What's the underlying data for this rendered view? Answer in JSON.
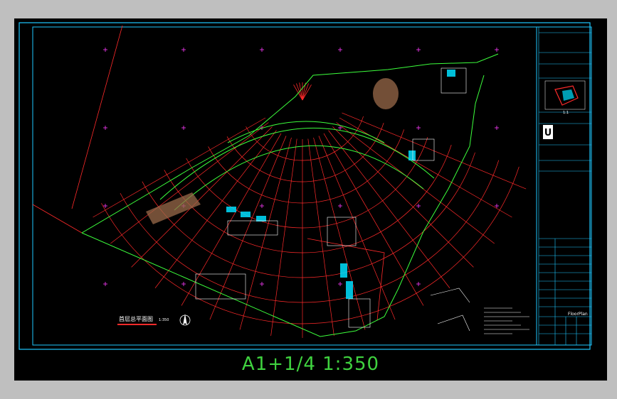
{
  "window": {
    "background": "#bfbfbf",
    "viewport_background": "#000000"
  },
  "drawing": {
    "scale_label": "A1+1/4   1:350",
    "plan_title": "首层总平面图",
    "plan_scale": "1:350",
    "north_icon": "north-arrow-icon"
  },
  "title_block": {
    "logo_icon": "company-logo-icon",
    "logo_letter": "U",
    "key_plan_scale": "1:1",
    "table_label": "FloorPlan"
  },
  "colors": {
    "frame": "#1ec8ff",
    "grid_radial": "#ff2a2a",
    "structure": "#3cff3c",
    "markers": "#ff3cff",
    "highlight": "#00e0ff",
    "hatch": "#9a6a4a",
    "text": "#ffffff",
    "scale_label": "#3fd23f"
  }
}
